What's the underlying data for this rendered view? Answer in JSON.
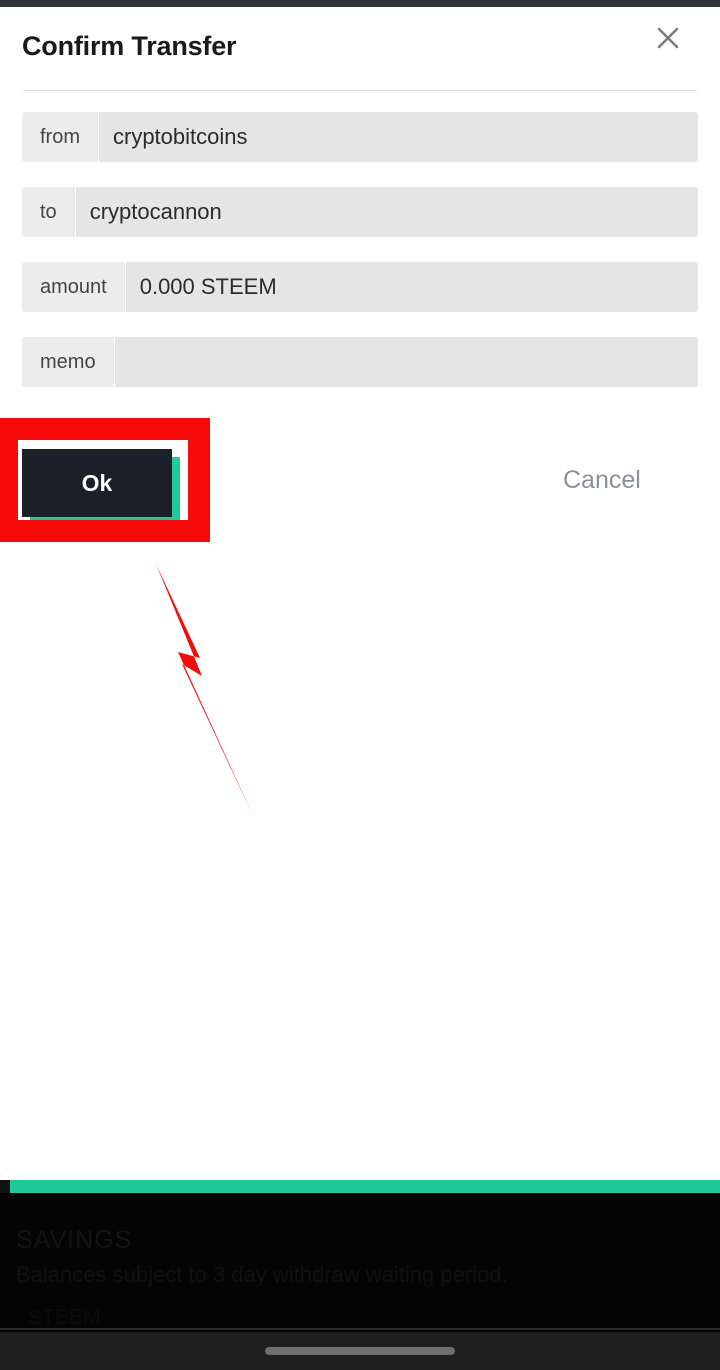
{
  "dialog": {
    "title": "Confirm Transfer",
    "close_icon": "close-icon",
    "fields": [
      {
        "label": "from",
        "value": "cryptobitcoins"
      },
      {
        "label": "to",
        "value": "cryptocannon"
      },
      {
        "label": "amount",
        "value": "0.000 STEEM"
      },
      {
        "label": "memo",
        "value": ""
      }
    ],
    "ok_label": "Ok",
    "cancel_label": "Cancel"
  },
  "annotation": {
    "highlight_color": "#f60a0a",
    "target": "ok-button",
    "arrow_icon": "arrow-up-icon"
  },
  "background_app": {
    "section_title": "SAVINGS",
    "section_subtitle": "Balances subject to 3 day withdraw waiting period.",
    "row_label": "STEEM",
    "accent_color": "#1fc99a"
  },
  "system": {
    "nav_handle": "gesture-pill"
  },
  "colors": {
    "button_dark": "#1a202a",
    "accent_teal": "#1fc99a",
    "annotation_red": "#f60a0a",
    "field_bg": "#e5e5e5",
    "label_bg": "#ececec"
  }
}
